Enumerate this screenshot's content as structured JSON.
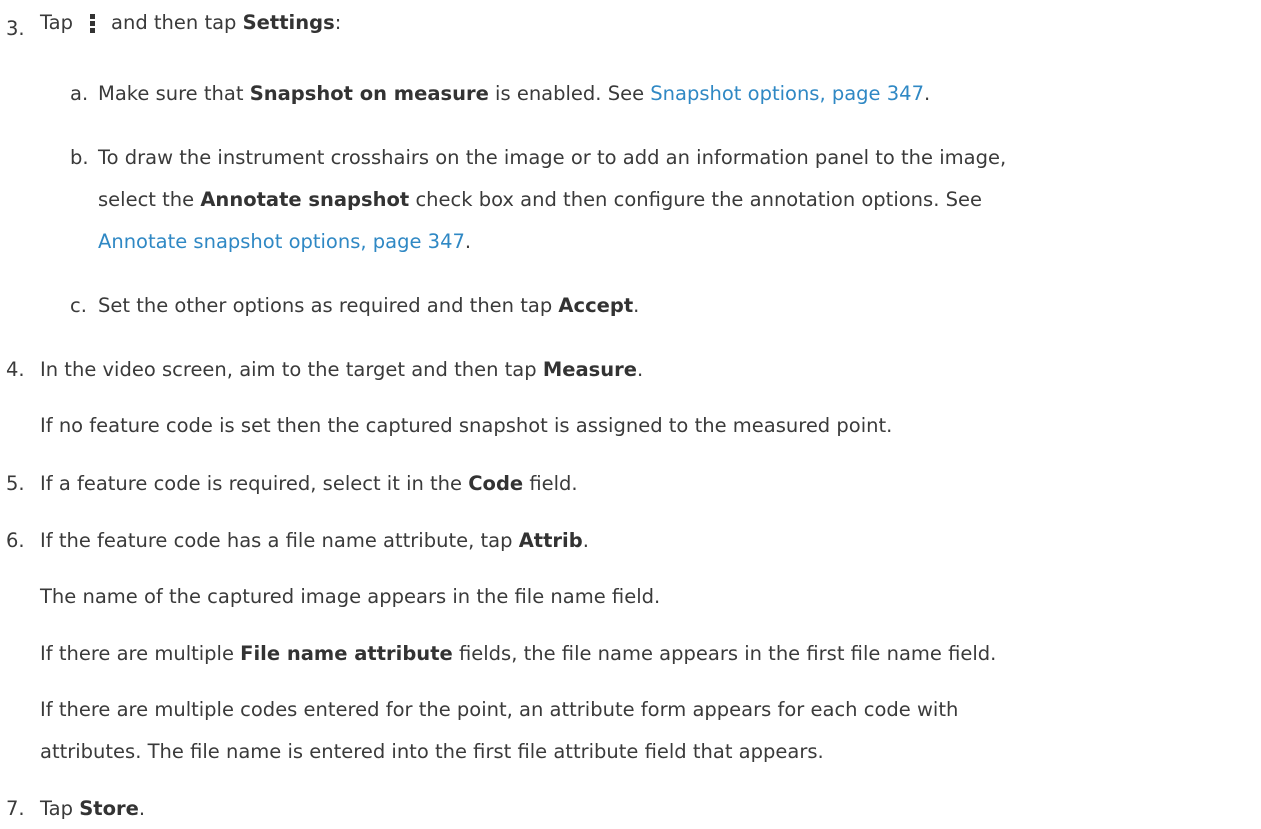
{
  "step3": {
    "number": "3.",
    "tap": "Tap",
    "icon": "more-vertical-icon",
    "mid": "and then tap",
    "bold": "Settings",
    "end": ":",
    "sub_a": {
      "letter": "a.",
      "pre": "Make sure that",
      "bold": "Snapshot on measure",
      "mid": "is enabled. See",
      "link": "Snapshot options, page 347",
      "end": "."
    },
    "sub_b": {
      "letter": "b.",
      "line1": "To draw the instrument crosshairs on the image or to add an information panel to the image,",
      "line2_pre": "select the",
      "line2_bold": "Annotate snapshot",
      "line2_post": "check box and then configure the annotation options. See",
      "link": "Annotate snapshot options, page 347",
      "end": "."
    },
    "sub_c": {
      "letter": "c.",
      "pre": "Set the other options as required and then tap",
      "bold": "Accept",
      "end": "."
    }
  },
  "step4": {
    "number": "4.",
    "pre": "In the video screen, aim to the target and then tap",
    "bold": "Measure",
    "end": ".",
    "note": "If no feature code is set then the captured snapshot is assigned to the measured point."
  },
  "step5": {
    "number": "5.",
    "pre": "If a feature code is required, select it in the",
    "bold": "Code",
    "post": "field."
  },
  "step6": {
    "number": "6.",
    "pre": "If the feature code has a file name attribute, tap",
    "bold": "Attrib",
    "end": ".",
    "note1": "The name of the captured image appears in the file name field.",
    "note2_pre": "If there are multiple",
    "note2_bold": "File name attribute",
    "note2_post": "fields, the file name appears in the first file name field.",
    "note3_line1": "If there are multiple codes entered for the point, an attribute form appears for each code with",
    "note3_line2": "attributes. The file name is entered into the first file attribute field that appears."
  },
  "step7": {
    "number": "7.",
    "tap": "Tap",
    "bold": "Store",
    "end": "."
  }
}
